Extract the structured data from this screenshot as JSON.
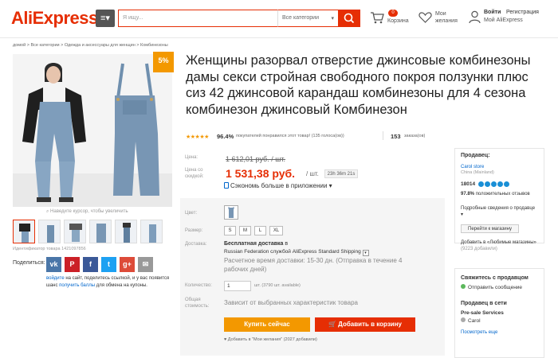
{
  "header": {
    "logo": "AliExpress",
    "search_placeholder": "Я ищу...",
    "category_select": "Все категории",
    "cart_count": "0",
    "cart_label": "Корзина",
    "wishlist_label": "Мои желания",
    "login": "Войти",
    "register": "Регистрация",
    "my_account": "Мой AliExpress"
  },
  "breadcrumb": "домой > Все категории > Одежда и аксессуары для женщин > Комбинезоны",
  "gallery": {
    "discount_badge": "5%",
    "zoom_hint": "Наведите курсор, чтобы увеличить",
    "sku_id": "Идентификатор товара 1421097856",
    "share_label": "Поделиться:",
    "share_buttons": [
      "vk",
      "P",
      "f",
      "t",
      "g+",
      "✉"
    ],
    "promo_login": "войдите",
    "promo_mid": " на сайт, поделитесь ссылкой, и у вас появится шанс ",
    "promo_points": "получить баллы",
    "promo_tail": " для обмена на купоны."
  },
  "product": {
    "title": "Женщины разорвал отверстие джинсовые комбинезоны дамы секси стройная свободного покроя ползунки плюс сиз 42 джинсовой карандаш комбинезоны для 4 сезона комбинезон джинсовый Комбинезон",
    "stars": "★★★★★",
    "rating_percent": "96.4%",
    "rating_text": "покупателей понравился этот товар! (135 голоса(ов))",
    "orders_count": "153",
    "orders_label": "заказа(ов)"
  },
  "pricing": {
    "price_label": "Цена:",
    "old_price": "1 612,01 руб. / шт.",
    "discount_label": "Цена со скидкой:",
    "new_price": "1 531,38 руб.",
    "unit": "/ шт.",
    "timer": "23h 36m 21s",
    "app_save": "Сэкономь больше в приложении ▾"
  },
  "options": {
    "color_label": "Цвет:",
    "size_label": "Размер:",
    "sizes": [
      "S",
      "M",
      "L",
      "XL"
    ],
    "shipping_label": "Доставка:",
    "free_shipping": "Бесплатная доставка",
    "free_shipping_tail": " в",
    "shipping_method": "Russian Federation службой AliExpress Standard Shipping",
    "delivery_time": "Расчетное время доставки: 15-30 дн. (Отправка в течение 4 рабочих дней)",
    "qty_label": "Количество:",
    "qty_value": "1",
    "qty_note": "шт. (3790 шт. available)",
    "total_label": "Общая стоимость:",
    "total_value": "Зависит от выбранных характеристик товара",
    "buy_now": "Купить сейчас",
    "add_to_cart": "Добавить в корзину",
    "add_wish": "Добавить в \"Мои желания\" (2027 добавили)"
  },
  "seller": {
    "heading": "Продавец:",
    "store_name": "Carol store",
    "country": "China (Mainland)",
    "score": "18014",
    "positive_pct": "97.8%",
    "positive_text": "положительных отзывов",
    "about": "Подробные сведения о продавце ▾",
    "goto_store": "Перейти к магазину",
    "fav_store": "Добавить в «Любимые магазины»",
    "fav_count": "(9223 добавили)"
  },
  "contact": {
    "heading": "Свяжитесь с продавцом",
    "send_message": "Отправить сообщение",
    "network_heading": "Продавец в сети",
    "presale": "Pre-sale Services",
    "agent": "Carol",
    "see_more": "Посмотреть еще"
  },
  "colors": {
    "brand": "#e62e04",
    "orange": "#f39800",
    "link": "#0066cc",
    "medal": "#1a8fd6"
  }
}
